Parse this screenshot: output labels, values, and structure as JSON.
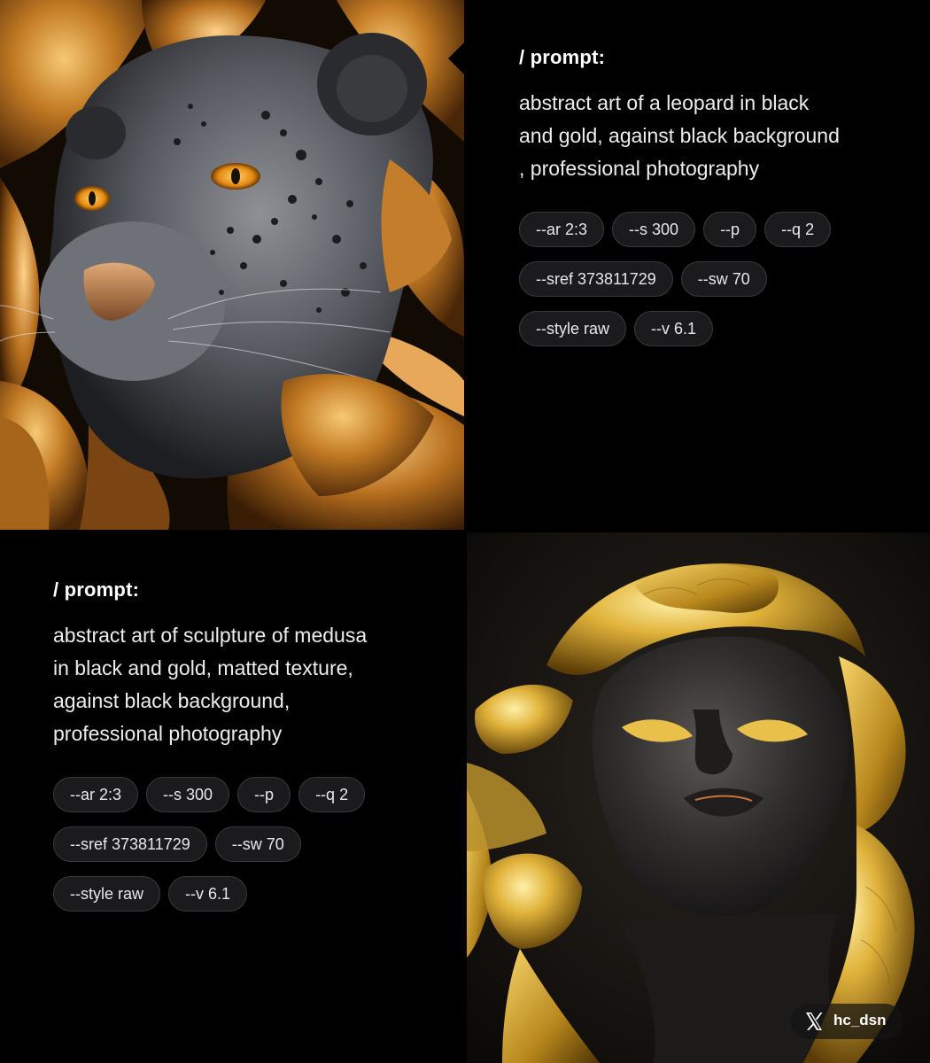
{
  "cards": [
    {
      "heading": "/ prompt:",
      "body": "abstract art of a leopard in black\nand gold, against black background\n, professional photography",
      "chips": [
        [
          "--ar 2:3",
          "--s 300",
          "--p",
          "--q 2"
        ],
        [
          "--sref 373811729",
          "--sw 70"
        ],
        [
          "--style raw",
          "--v 6.1"
        ]
      ]
    },
    {
      "heading": "/ prompt:",
      "body": "abstract art of sculpture of medusa\nin black and gold, matted texture,\nagainst black background,\nprofessional photography",
      "chips": [
        [
          "--ar 2:3",
          "--s 300",
          "--p",
          "--q 2"
        ],
        [
          "--sref 373811729",
          "--sw 70"
        ],
        [
          "--style raw",
          "--v 6.1"
        ]
      ]
    }
  ],
  "watermark": {
    "icon": "x-logo-icon",
    "handle": "hc_dsn"
  },
  "colors": {
    "background": "#000000",
    "chip_bg": "#1b1b1d",
    "chip_border": "#3a3a3d",
    "gold": "#c98a2c",
    "fur": "#5a5d63"
  }
}
